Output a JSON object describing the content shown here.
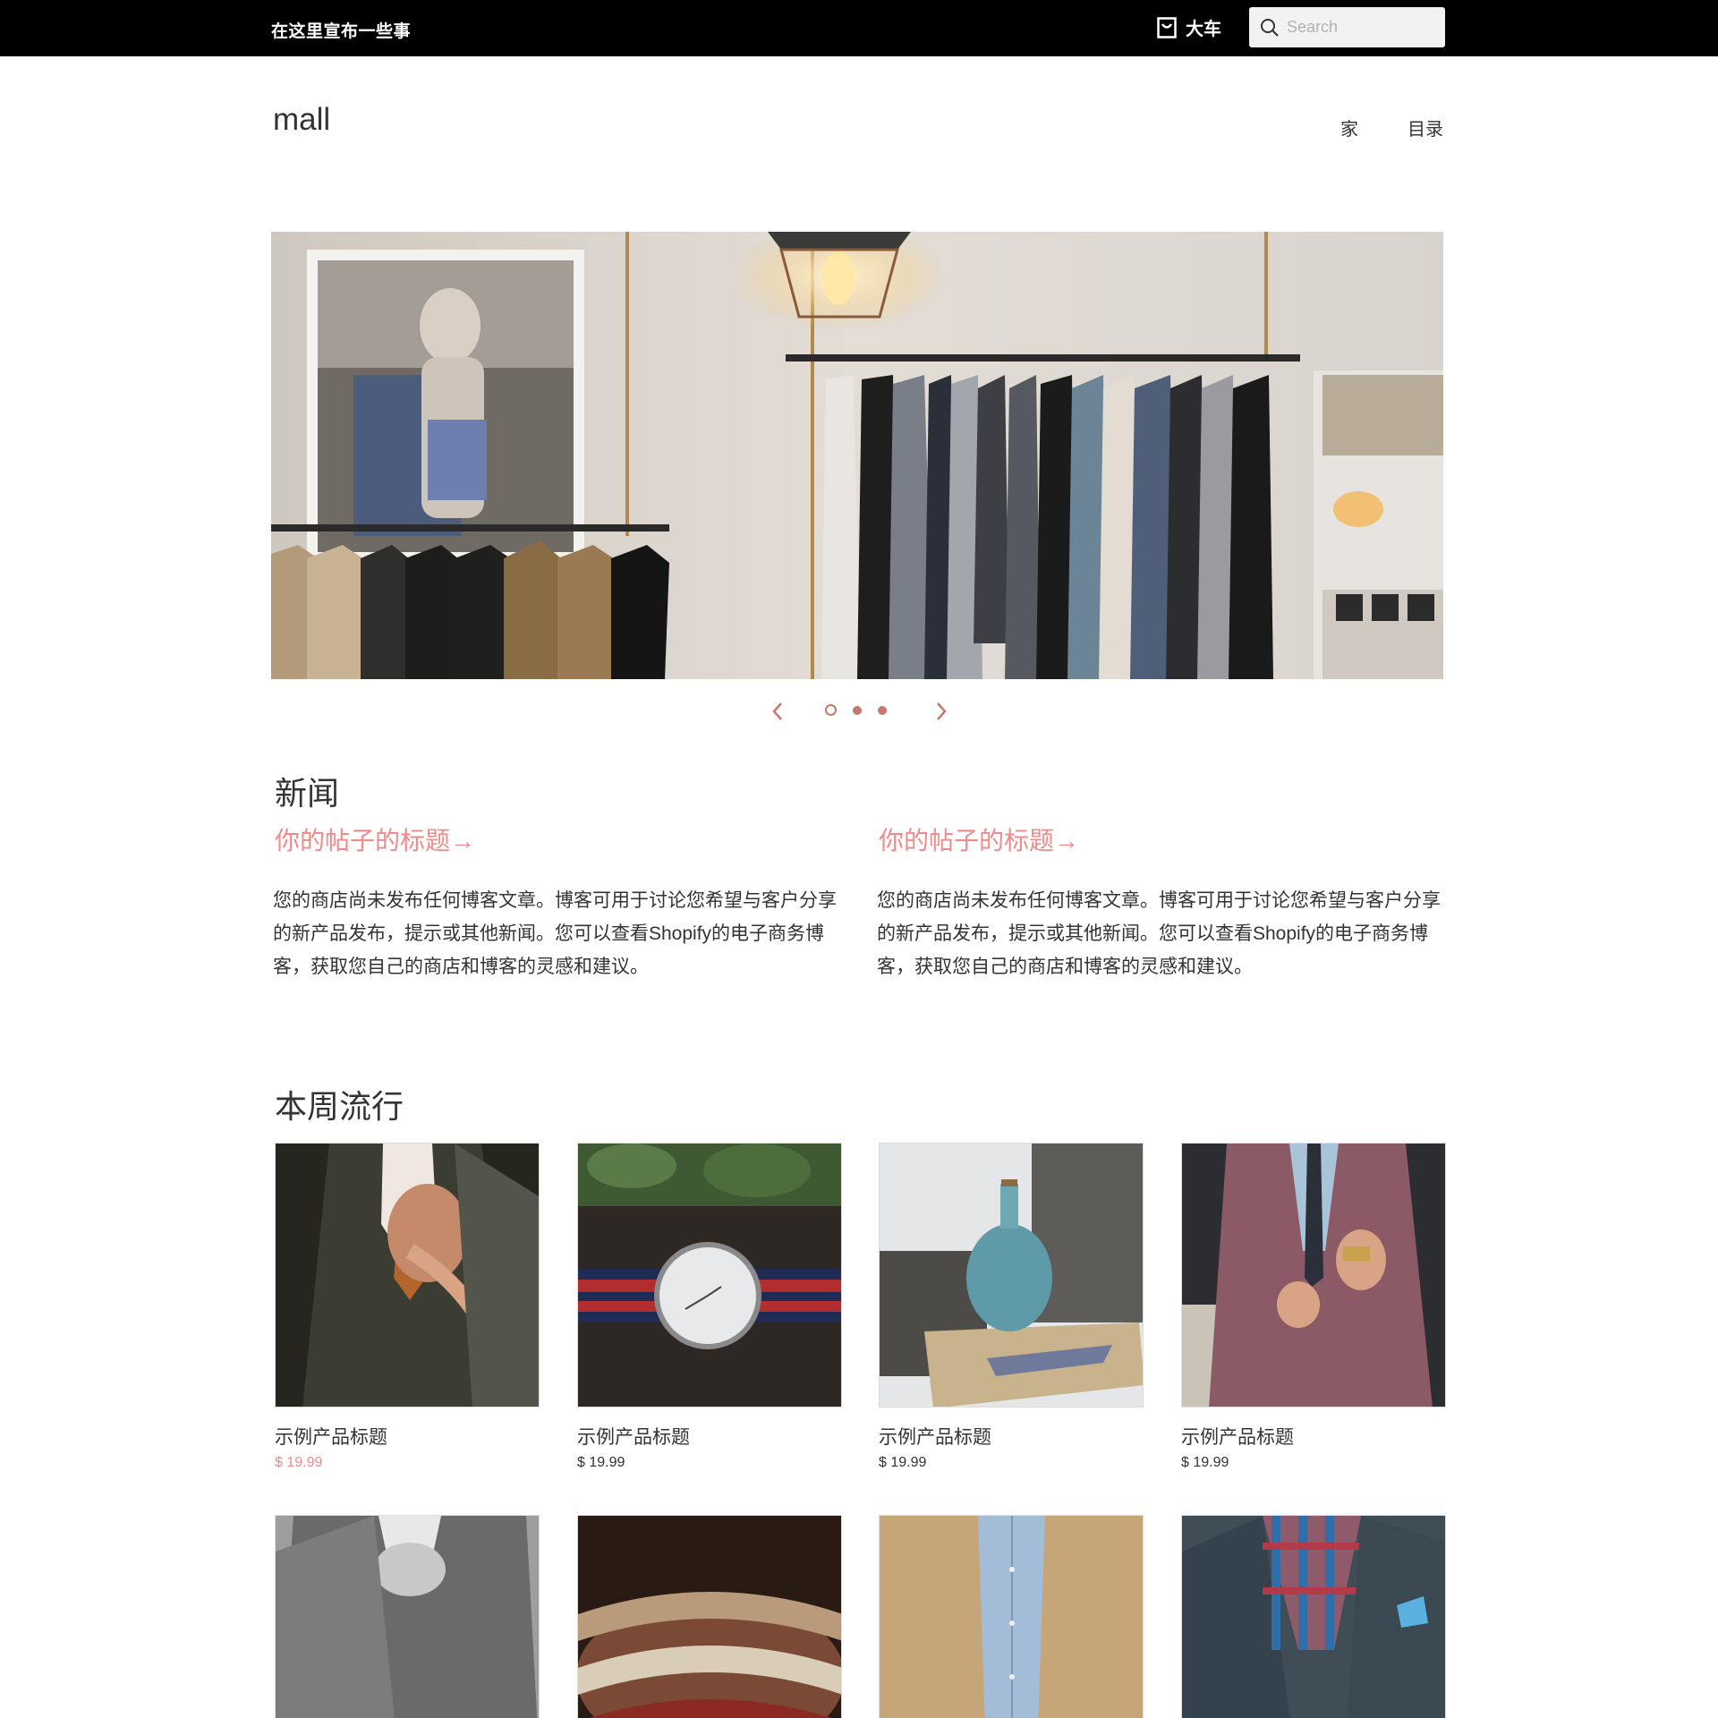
{
  "announcement": "在这里宣布一些事",
  "cart": {
    "label": "大车",
    "icon": "cart-icon"
  },
  "search": {
    "placeholder": "Search",
    "value": ""
  },
  "header": {
    "logo": "mall",
    "nav": [
      "家",
      "目录"
    ]
  },
  "slideshow": {
    "slide_count": 3,
    "current": 1,
    "icons": [
      "chevron-left-icon",
      "chevron-right-icon"
    ]
  },
  "news": {
    "title": "新闻",
    "posts": [
      {
        "title": "你的帖子的标题→",
        "body": "您的商店尚未发布任何博客文章。博客可用于讨论您希望与客户分享的新产品发布，提示或其他新闻。您可以查看Shopify的电子商务博客，获取您自己的商店和博客的灵感和建议。"
      },
      {
        "title": "你的帖子的标题→",
        "body": "您的商店尚未发布任何博客文章。博客可用于讨论您希望与客户分享的新产品发布，提示或其他新闻。您可以查看Shopify的电子商务博客，获取您自己的商店和博客的灵感和建议。"
      }
    ]
  },
  "trending": {
    "title": "本周流行",
    "products": [
      {
        "title": "示例产品标题",
        "price": "$ 19.99"
      },
      {
        "title": "示例产品标题",
        "price": "$ 19.99"
      },
      {
        "title": "示例产品标题",
        "price": "$ 19.99"
      },
      {
        "title": "示例产品标题",
        "price": "$ 19.99"
      },
      {
        "title": "",
        "price": ""
      },
      {
        "title": "",
        "price": ""
      },
      {
        "title": "",
        "price": ""
      },
      {
        "title": "",
        "price": ""
      }
    ]
  },
  "colors": {
    "topbar": "#000000",
    "accent": "#f08b8b",
    "slider_accent": "#c8776d",
    "text": "#333333"
  }
}
